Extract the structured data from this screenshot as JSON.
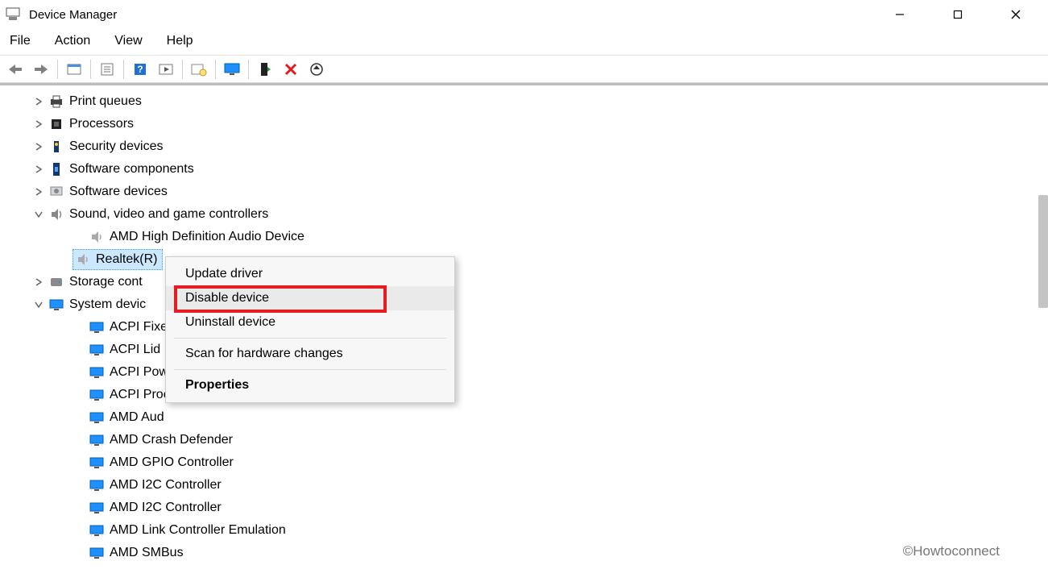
{
  "window": {
    "title": "Device Manager"
  },
  "menus": {
    "file": "File",
    "action": "Action",
    "view": "View",
    "help": "Help"
  },
  "toolbar_icons": [
    "back-arrow-icon",
    "forward-arrow-icon",
    "show-hidden-icon",
    "properties-icon",
    "help-icon",
    "action-icon",
    "scan-icon",
    "monitor-icon",
    "enable-icon",
    "disable-icon",
    "update-icon"
  ],
  "tree": [
    {
      "level": 0,
      "expander": ">",
      "icon": "printer-icon",
      "label": "Print queues"
    },
    {
      "level": 0,
      "expander": ">",
      "icon": "cpu-icon",
      "label": "Processors"
    },
    {
      "level": 0,
      "expander": ">",
      "icon": "security-icon",
      "label": "Security devices"
    },
    {
      "level": 0,
      "expander": ">",
      "icon": "component-icon",
      "label": "Software components"
    },
    {
      "level": 0,
      "expander": ">",
      "icon": "software-icon",
      "label": "Software devices"
    },
    {
      "level": 0,
      "expander": "v",
      "icon": "sound-icon",
      "label": "Sound, video and game controllers"
    },
    {
      "level": 1,
      "expander": "",
      "icon": "speaker-icon",
      "label": "AMD High Definition Audio Device"
    },
    {
      "level": 1,
      "expander": "",
      "icon": "speaker-icon",
      "label": "Realtek(R) Audio",
      "selected": true,
      "truncated": "Realtek(R)"
    },
    {
      "level": 0,
      "expander": ">",
      "icon": "storage-icon",
      "label": "Storage cont"
    },
    {
      "level": 0,
      "expander": "v",
      "icon": "system-icon",
      "label": "System devic"
    },
    {
      "level": 1,
      "expander": "",
      "icon": "device-icon",
      "label": "ACPI Fixe"
    },
    {
      "level": 1,
      "expander": "",
      "icon": "device-icon",
      "label": "ACPI Lid"
    },
    {
      "level": 1,
      "expander": "",
      "icon": "device-icon",
      "label": "ACPI Pow"
    },
    {
      "level": 1,
      "expander": "",
      "icon": "device-icon",
      "label": "ACPI Proc"
    },
    {
      "level": 1,
      "expander": "",
      "icon": "device-icon",
      "label": "AMD Aud"
    },
    {
      "level": 1,
      "expander": "",
      "icon": "device-icon",
      "label": "AMD Crash Defender"
    },
    {
      "level": 1,
      "expander": "",
      "icon": "device-icon",
      "label": "AMD GPIO Controller"
    },
    {
      "level": 1,
      "expander": "",
      "icon": "device-icon",
      "label": "AMD I2C Controller"
    },
    {
      "level": 1,
      "expander": "",
      "icon": "device-icon",
      "label": "AMD I2C Controller"
    },
    {
      "level": 1,
      "expander": "",
      "icon": "device-icon",
      "label": "AMD Link Controller Emulation"
    },
    {
      "level": 1,
      "expander": "",
      "icon": "device-icon",
      "label": "AMD SMBus"
    }
  ],
  "context_menu": {
    "items": [
      {
        "label": "Update driver",
        "type": "item"
      },
      {
        "label": "Disable device",
        "type": "item",
        "highlighted": true
      },
      {
        "label": "Uninstall device",
        "type": "item"
      },
      {
        "type": "separator"
      },
      {
        "label": "Scan for hardware changes",
        "type": "item"
      },
      {
        "type": "separator"
      },
      {
        "label": "Properties",
        "type": "item",
        "bold": true
      }
    ]
  },
  "watermark": "©Howtoconnect"
}
